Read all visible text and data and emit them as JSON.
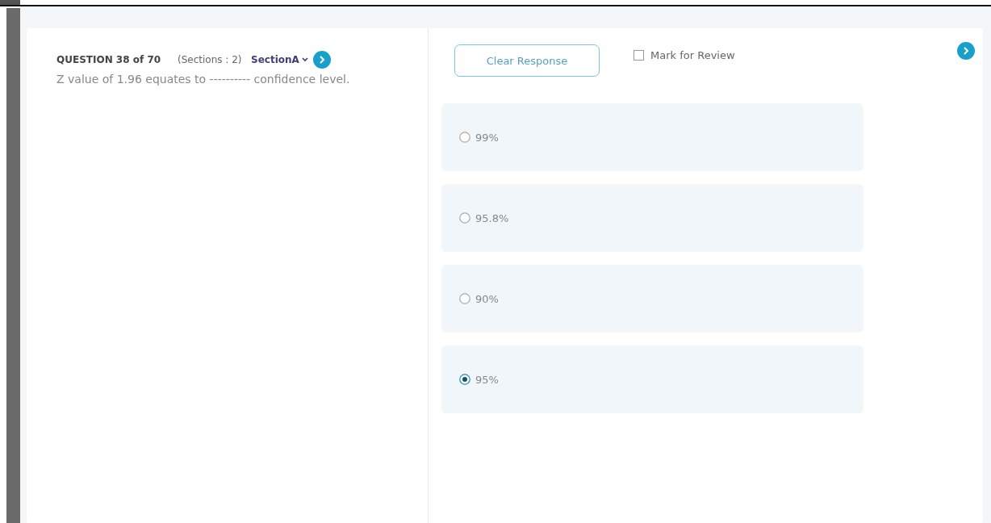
{
  "question": {
    "label": "QUESTION 38 of 70",
    "sections": "(Sections : 2)",
    "section": "SectionA",
    "text": "Z value of 1.96 equates to ---------- confidence level."
  },
  "clear_button": "Clear Response",
  "mark_for_review": {
    "label": "Mark for Review",
    "checked": false
  },
  "options": [
    {
      "label": "99%",
      "selected": false
    },
    {
      "label": "95.8%",
      "selected": false
    },
    {
      "label": "90%",
      "selected": false
    },
    {
      "label": "95%",
      "selected": true
    }
  ]
}
